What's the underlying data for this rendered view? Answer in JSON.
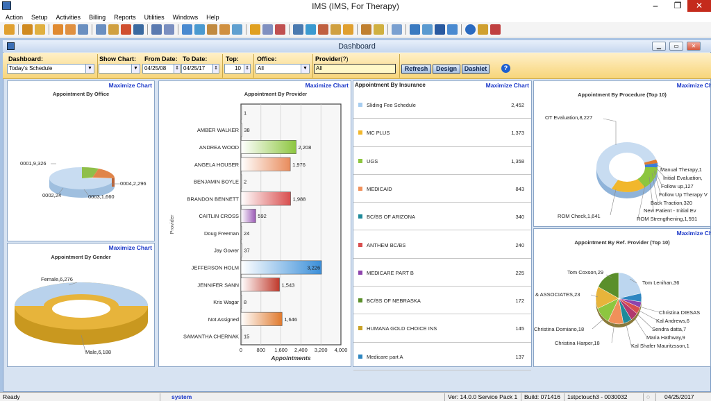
{
  "window": {
    "title": "IMS (IMS, For Therapy)",
    "min": "–",
    "restore": "❐",
    "close": "✕"
  },
  "menu": [
    "Action",
    "Setup",
    "Activities",
    "Billing",
    "Reports",
    "Utilities",
    "Windows",
    "Help"
  ],
  "dashboard_window": {
    "title": "Dashboard"
  },
  "filters": {
    "dashboard_label": "Dashboard:",
    "dashboard_value": "Today's Schedule",
    "show_chart_label": "Show Chart:",
    "show_chart_value": "",
    "from_label": "From Date:",
    "from_value": "04/25/08",
    "to_label": "To Date:",
    "to_value": "04/25/17",
    "top_label": "Top:",
    "top_value": "10",
    "office_label": "Office:",
    "office_value": "All",
    "provider_label": "Provider",
    "provider_hint": "(?)",
    "provider_value": "All",
    "refresh": "Refresh",
    "design": "Design",
    "dashlet": "Dashlet",
    "help": "?"
  },
  "maximize_label": "Maximize  Chart",
  "panels": {
    "office": {
      "title": "Appointment By Office",
      "chart_data": {
        "type": "pie",
        "labels": [
          "0001",
          "0002",
          "0003",
          "0004"
        ],
        "values": [
          9326,
          24,
          1660,
          2296
        ],
        "colors": [
          "#bcd6ef",
          "#bcd6ef",
          "#8fbf4a",
          "#e0854a"
        ],
        "annotations": [
          "0001,9,326",
          "0002,24",
          "0003,1,660",
          "0004,2,296"
        ]
      }
    },
    "gender": {
      "title": "Appointment By Gender",
      "chart_data": {
        "type": "pie",
        "labels": [
          "Female",
          "Male"
        ],
        "values": [
          6276,
          6188
        ],
        "colors": [
          "#b9d2ec",
          "#e7b43b"
        ],
        "annotations": [
          "Female,6,276",
          "Male,6,188"
        ]
      }
    },
    "provider": {
      "title": "Appointment By Provider",
      "chart_data": {
        "type": "bar",
        "orientation": "horizontal",
        "categories": [
          "",
          "AMBER WALKER",
          "ANDREA WOOD",
          "ANGELA HOUSER",
          "BENJAMIN BOYLE",
          "BRANDON BENNETT",
          "CAITLIN CROSS",
          "Doug Freeman",
          "Jay Gower",
          "JEFFERSON HOLM",
          "JENNIFER SANN",
          "Kris Wagar",
          "Not Assigned",
          "SAMANTHA CHERNAK"
        ],
        "values": [
          1,
          38,
          2208,
          1976,
          2,
          1988,
          592,
          24,
          37,
          3226,
          1543,
          8,
          1646,
          15
        ],
        "value_labels": [
          "1",
          "38",
          "2,208",
          "1,976",
          "2",
          "1,988",
          "592",
          "24",
          "37",
          "3,226",
          "1,543",
          "8",
          "1,646",
          "15"
        ],
        "colors": [
          "#999",
          "#999",
          "#8dc63f",
          "#e98c5c",
          "#999",
          "#d94f4f",
          "#9b59b6",
          "#999",
          "#999",
          "#3b8fd9",
          "#c0392b",
          "#999",
          "#e07a2e",
          "#999"
        ],
        "xlim": [
          0,
          4000
        ],
        "xticks": [
          "0",
          "800",
          "1,600",
          "2,400",
          "3,200",
          "4,000"
        ],
        "xlabel": "Appointments",
        "ylabel": "Provider"
      }
    },
    "insurance": {
      "title": "Appointment By Insurance",
      "chart_data": {
        "type": "table",
        "rows": [
          {
            "name": "Sliding Fee Schedule",
            "value": "2,452",
            "color": "#a7cdf0"
          },
          {
            "name": "MC PLUS",
            "value": "1,373",
            "color": "#f1b72c"
          },
          {
            "name": "UGS",
            "value": "1,358",
            "color": "#8dc63f"
          },
          {
            "name": "MEDICAID",
            "value": "843",
            "color": "#f0905a"
          },
          {
            "name": "BC/BS OF ARIZONA",
            "value": "340",
            "color": "#1e8a9a"
          },
          {
            "name": "ANTHEM BC/BS",
            "value": "240",
            "color": "#d94f4f"
          },
          {
            "name": "MEDICARE PART B",
            "value": "225",
            "color": "#8e44ad"
          },
          {
            "name": "BC/BS OF NEBRASKA",
            "value": "172",
            "color": "#5a8f2a"
          },
          {
            "name": "HUMANA GOLD CHOICE INS",
            "value": "145",
            "color": "#c9a227"
          },
          {
            "name": "Medicare part A",
            "value": "137",
            "color": "#2e86c1"
          }
        ]
      }
    },
    "procedure": {
      "title": "Appointment By Procedure (Top 10)",
      "chart_data": {
        "type": "pie",
        "style": "donut",
        "labels": [
          "OT Evaluation",
          "Manual Therapy",
          "Initial Evaluation",
          "Follow up",
          "Follow Up Therapy V",
          "Back Traction",
          "New Patient - Initial Ev",
          "ROM Strengthening",
          "ROM Check"
        ],
        "values": [
          8227,
          900,
          600,
          127,
          400,
          320,
          300,
          1591,
          1641
        ],
        "colors": [
          "#bcd6ef",
          "#3b7dd8",
          "#e07a2e",
          "#8e44ad",
          "#d94f4f",
          "#1e8a9a",
          "#c0392b",
          "#8dc63f",
          "#f1b72c"
        ],
        "annotations": [
          "OT Evaluation,8,227",
          "Manual Therapy,1",
          "Initial Evaluation,",
          "Follow up,127",
          "Follow Up Therapy V",
          "Back Traction,320",
          "New Patient - Initial Ev",
          "ROM Strengthening,1,591",
          "ROM Check,1,641"
        ]
      }
    },
    "referral": {
      "title": "Appointment By Ref. Provider (Top 10)",
      "chart_data": {
        "type": "pie",
        "labels": [
          "Tom Lenihan",
          "Christina DIESAS",
          "Kal Andrews",
          "Sendra datta",
          "Maria Hathway",
          "Kal Shafer Mauritzsson",
          "Christina Harper",
          "Christina Domiano",
          "& ASSOCIATES",
          "Tom Coxson"
        ],
        "values": [
          36,
          9,
          6,
          7,
          9,
          10,
          18,
          18,
          23,
          29
        ],
        "colors": [
          "#bcd6ef",
          "#2e86c1",
          "#8e44ad",
          "#d94f4f",
          "#b03a6f",
          "#1e8a9a",
          "#f0905a",
          "#8dc63f",
          "#e7b43b",
          "#5a8f2a"
        ],
        "annotations": [
          "Tom Lenihan,36",
          "Christina DIESAS",
          "Kal Andrews,6",
          "Sendra datta,7",
          "Maria Hathway,9",
          "Kal Shafer Mauritzsson,1",
          "Christina Harper,18",
          "Christina Domiano,18",
          "& ASSOCIATES,23",
          "Tom Coxson,29"
        ]
      }
    }
  },
  "status": {
    "ready": "Ready",
    "user": "system",
    "version": "Ver: 14.0.0 Service Pack 1",
    "build": "Build: 071416",
    "session": "1stpctouch3 - 0030032",
    "date": "04/25/2017"
  }
}
